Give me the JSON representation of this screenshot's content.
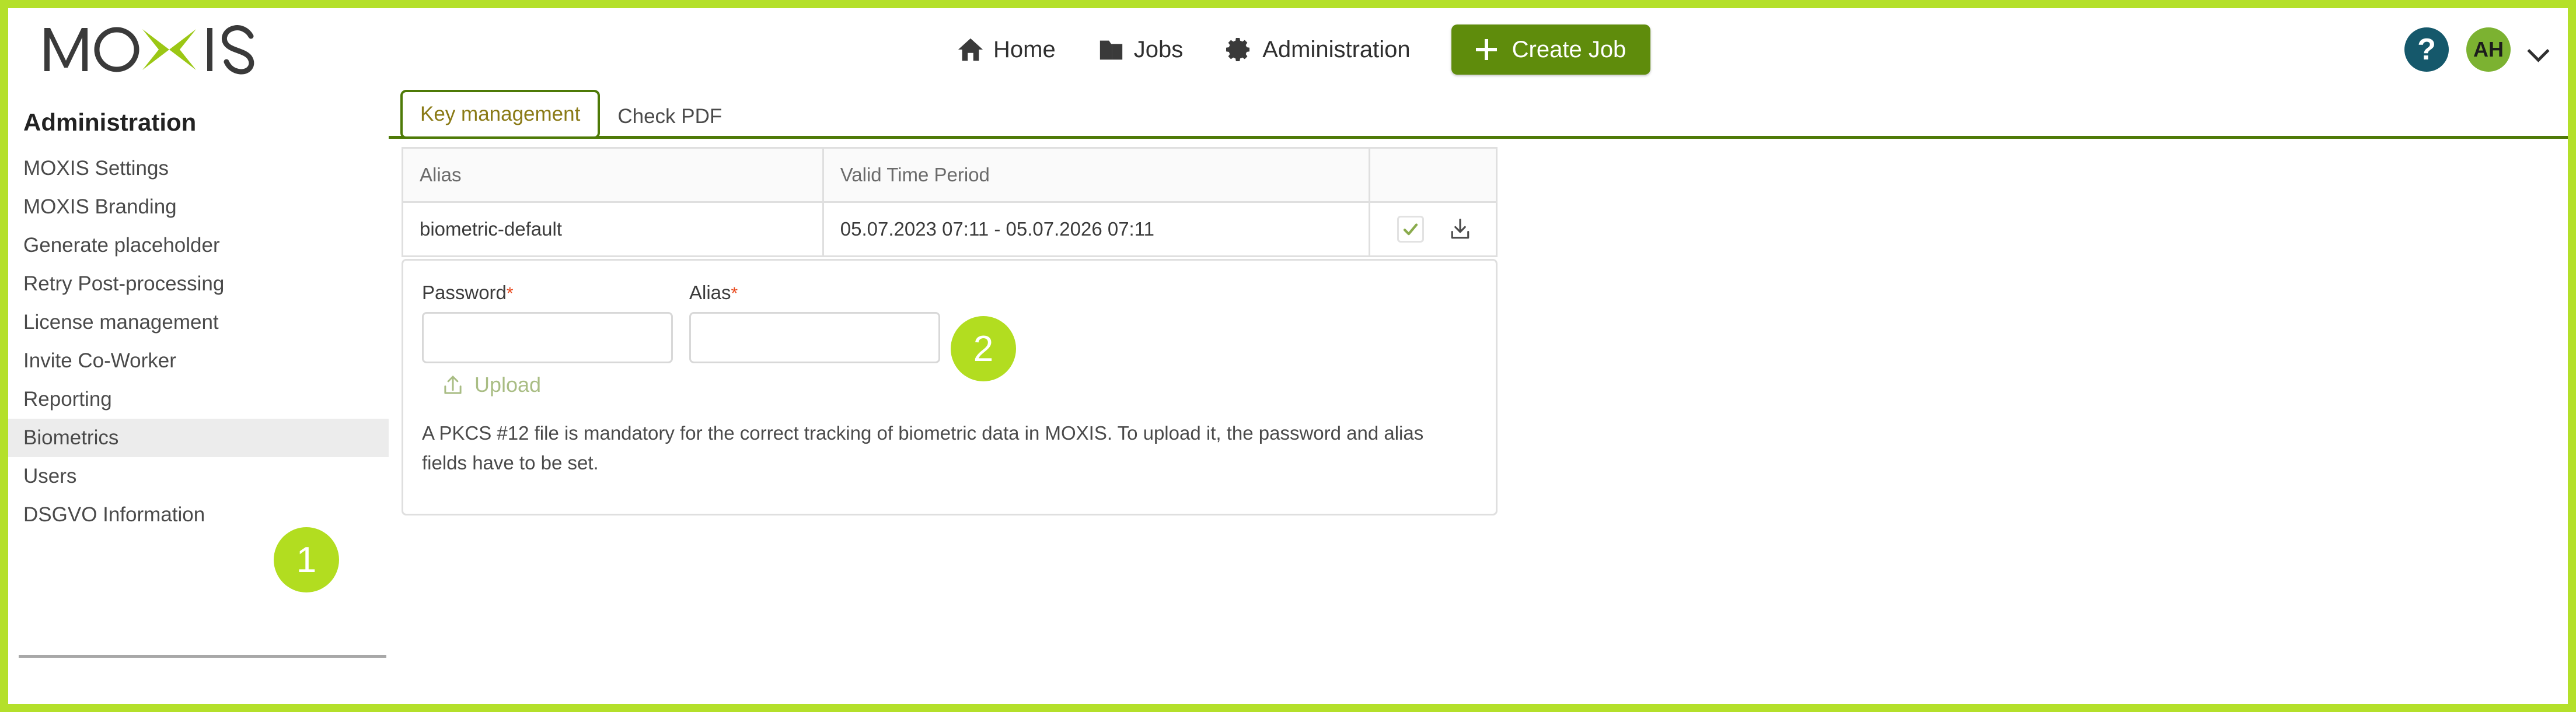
{
  "brand": {
    "logo_text": "MOXIS",
    "accent_green": "#b4e02a",
    "button_green": "#5f8c0c",
    "tab_green": "#4e7a07",
    "help_teal": "#15586b",
    "avatar_green": "#7cb231"
  },
  "header": {
    "nav": [
      {
        "label": "Home",
        "icon": "home-icon"
      },
      {
        "label": "Jobs",
        "icon": "folder-icon"
      },
      {
        "label": "Administration",
        "icon": "gear-icon"
      }
    ],
    "create_job_label": "Create Job",
    "help_label": "?",
    "avatar_initials": "AH"
  },
  "sidebar": {
    "title": "Administration",
    "items": [
      {
        "label": "MOXIS Settings",
        "active": false
      },
      {
        "label": "MOXIS Branding",
        "active": false
      },
      {
        "label": "Generate placeholder",
        "active": false
      },
      {
        "label": "Retry Post-processing",
        "active": false
      },
      {
        "label": "License management",
        "active": false
      },
      {
        "label": "Invite Co-Worker",
        "active": false
      },
      {
        "label": "Reporting",
        "active": false
      },
      {
        "label": "Biometrics",
        "active": true
      },
      {
        "label": "Users",
        "active": false
      },
      {
        "label": "DSGVO Information",
        "active": false
      }
    ]
  },
  "content": {
    "tabs": [
      {
        "label": "Key management",
        "active": true
      },
      {
        "label": "Check PDF",
        "active": false
      }
    ],
    "key_table": {
      "columns": [
        "Alias",
        "Valid Time Period",
        ""
      ],
      "rows": [
        {
          "alias": "biometric-default",
          "valid_time_period": "05.07.2023 07:11 - 05.07.2026 07:11",
          "actions": [
            "check-icon",
            "download-icon"
          ]
        }
      ]
    },
    "upload_panel": {
      "password_label": "Password",
      "password_required_mark": "*",
      "password_value": "",
      "password_placeholder": "",
      "alias_label": "Alias",
      "alias_required_mark": "*",
      "alias_value": "",
      "alias_placeholder": "",
      "upload_label": "Upload",
      "help_text": "A PKCS #12 file is mandatory for the correct tracking of biometric data in MOXIS. To upload it, the password and alias fields have to be set."
    }
  },
  "callouts": [
    {
      "number": "1"
    },
    {
      "number": "2"
    }
  ]
}
